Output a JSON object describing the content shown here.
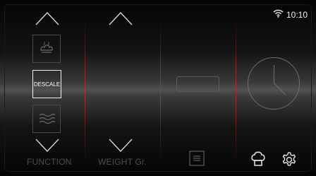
{
  "status_bar": {
    "time": "10:10",
    "wifi_icon": "wifi-icon"
  },
  "function_column": {
    "selected_label": "DESCALE",
    "footer_label": "FUNCTION",
    "icons": [
      "steam-icon",
      "heat-waves-icon"
    ]
  },
  "weight_column": {
    "footer_label": "WEIGHT Gr."
  },
  "center_column": {
    "footer_icon": "list-icon"
  },
  "right_column": {
    "clock_icon": "clock-icon",
    "chef_icon": "chef-hat-icon",
    "settings_icon": "gear-icon"
  },
  "colors": {
    "divider_accent": "#c82828",
    "text_dim": "#4e4e4e",
    "text_bright": "#ffffff"
  }
}
